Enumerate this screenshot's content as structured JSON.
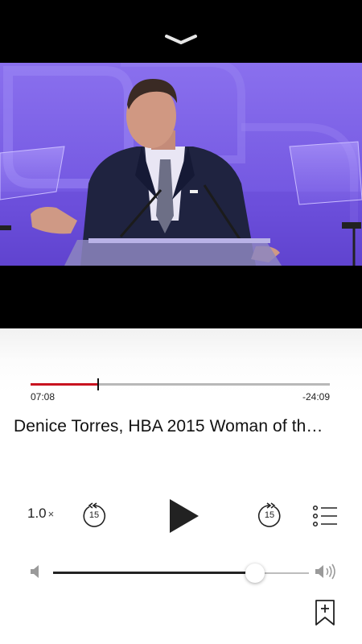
{
  "player": {
    "elapsed": "07:08",
    "remaining": "-24:09",
    "progress_fraction": 0.226,
    "episode_title": "Denice Torres, HBA 2015 Woman of th…",
    "speed_value": "1.0",
    "speed_suffix": "×",
    "skip_back_seconds": "15",
    "skip_forward_seconds": "15",
    "volume_fraction": 0.79
  },
  "icons": {
    "collapse": "chevron-down-icon",
    "skip_back": "skip-back-15-icon",
    "play": "play-icon",
    "skip_forward": "skip-forward-15-icon",
    "episode_list": "list-icon",
    "volume_min": "speaker-low-icon",
    "volume_max": "speaker-high-icon",
    "bookmark": "bookmark-add-icon"
  },
  "colors": {
    "progress_played": "#c8131f",
    "progress_remaining": "#b8b8b8",
    "video_backdrop": "#7f64e6"
  }
}
